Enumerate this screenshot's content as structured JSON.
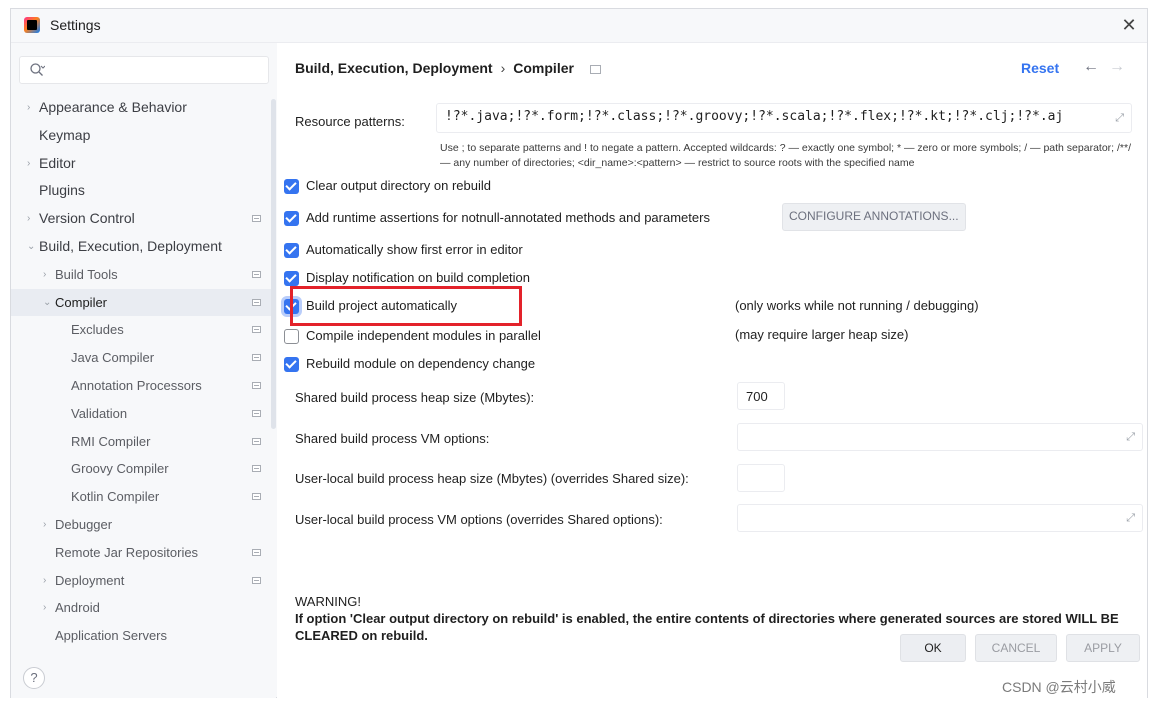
{
  "window": {
    "title": "Settings"
  },
  "search": {
    "placeholder": ""
  },
  "sidebar": {
    "items": [
      {
        "label": "Appearance & Behavior",
        "chevron": "›"
      },
      {
        "label": "Keymap"
      },
      {
        "label": "Editor",
        "chevron": "›"
      },
      {
        "label": "Plugins"
      },
      {
        "label": "Version Control",
        "chevron": "›"
      },
      {
        "label": "Build, Execution, Deployment",
        "chevron": "⌄"
      },
      {
        "label": "Build Tools",
        "chevron": "›"
      },
      {
        "label": "Compiler",
        "chevron": "⌄"
      },
      {
        "label": "Excludes"
      },
      {
        "label": "Java Compiler"
      },
      {
        "label": "Annotation Processors"
      },
      {
        "label": "Validation"
      },
      {
        "label": "RMI Compiler"
      },
      {
        "label": "Groovy Compiler"
      },
      {
        "label": "Kotlin Compiler"
      },
      {
        "label": "Debugger",
        "chevron": "›"
      },
      {
        "label": "Remote Jar Repositories"
      },
      {
        "label": "Deployment",
        "chevron": "›"
      },
      {
        "label": "Android",
        "chevron": "›"
      },
      {
        "label": "Application Servers"
      }
    ],
    "help": "?"
  },
  "header": {
    "crumb1": "Build, Execution, Deployment",
    "sep": "›",
    "crumb2": "Compiler",
    "reset": "Reset",
    "back": "←",
    "forward": "→"
  },
  "form": {
    "resource_label": "Resource patterns:",
    "resource_value": "!?*.java;!?*.form;!?*.class;!?*.groovy;!?*.scala;!?*.flex;!?*.kt;!?*.clj;!?*.aj",
    "hint": "Use ; to separate patterns and ! to negate a pattern. Accepted wildcards: ? — exactly one symbol; * — zero or more symbols; / — path separator; /**/ — any number of directories; <dir_name>:<pattern> — restrict to source roots with the specified name",
    "checkboxes": [
      {
        "label": "Clear output directory on rebuild",
        "checked": true
      },
      {
        "label": "Add runtime assertions for notnull-annotated methods and parameters",
        "checked": true
      },
      {
        "label": "Automatically show first error in editor",
        "checked": true
      },
      {
        "label": "Display notification on build completion",
        "checked": true
      },
      {
        "label": "Build project automatically",
        "checked": true
      },
      {
        "label": "Compile independent modules in parallel",
        "checked": false
      },
      {
        "label": "Rebuild module on dependency change",
        "checked": true
      }
    ],
    "configure_annotations": "CONFIGURE ANNOTATIONS...",
    "note_build_auto": "(only works while not running / debugging)",
    "note_parallel": "(may require larger heap size)",
    "heap_label": "Shared build process heap size (Mbytes):",
    "heap_value": "700",
    "vm_label": "Shared build process VM options:",
    "vm_value": "",
    "local_heap_label": "User-local build process heap size (Mbytes) (overrides Shared size):",
    "local_heap_value": "",
    "local_vm_label": "User-local build process VM options (overrides Shared options):",
    "local_vm_value": ""
  },
  "warning": {
    "title": "WARNING!",
    "text": "If option 'Clear output directory on rebuild' is enabled, the entire contents of directories where generated sources are stored WILL BE CLEARED on rebuild."
  },
  "buttons": {
    "ok": "OK",
    "cancel": "CANCEL",
    "apply": "APPLY"
  },
  "watermark": "CSDN @云村小威",
  "colors": {
    "accent": "#3574f0",
    "highlight_box": "#e3222a",
    "selected_row": "#e9ecf2"
  }
}
